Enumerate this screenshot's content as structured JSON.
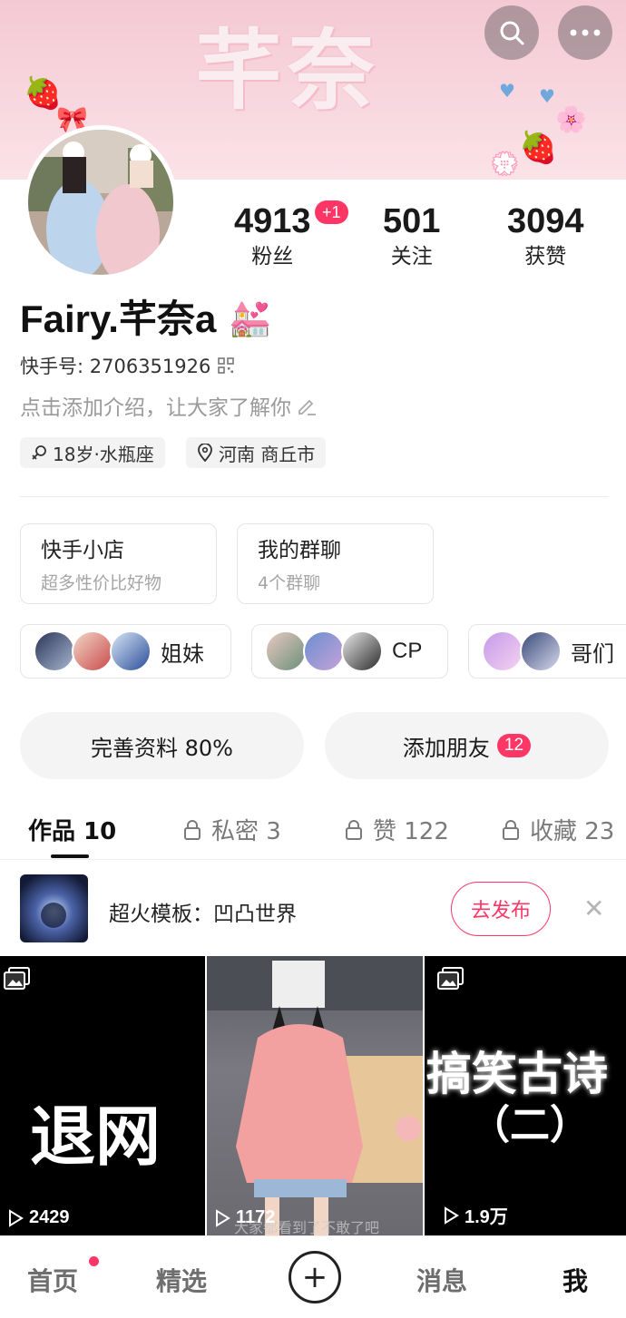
{
  "banner": {
    "title": "芊奈"
  },
  "stats": {
    "fans": {
      "value": "4913",
      "label": "粉丝",
      "badge": "+1"
    },
    "following": {
      "value": "501",
      "label": "关注"
    },
    "likes": {
      "value": "3094",
      "label": "获赞"
    }
  },
  "profile": {
    "name": "Fairy.芊奈a",
    "name_emoji": "💒",
    "id_label": "快手号: 2706351926",
    "intro": "点击添加介绍，让大家了解你",
    "tags": [
      "18岁·水瓶座",
      "河南 商丘市"
    ]
  },
  "cards": [
    {
      "title": "快手小店",
      "sub": "超多性价比好物"
    },
    {
      "title": "我的群聊",
      "sub": "4个群聊"
    }
  ],
  "groups": [
    "姐妹",
    "CP",
    "哥们"
  ],
  "actions": {
    "complete": "完善资料 80%",
    "add_friend": "添加朋友",
    "add_friend_count": "12"
  },
  "tabs": [
    {
      "label": "作品 10"
    },
    {
      "label": "私密 3"
    },
    {
      "label": "赞 122"
    },
    {
      "label": "收藏 23"
    }
  ],
  "promo": {
    "text": "超火模板：凹凸世界",
    "button": "去发布"
  },
  "videos": [
    {
      "caption": "退网",
      "views": "2429"
    },
    {
      "caption": "",
      "views": "1172",
      "overlay": "大家都看到了不敢了吧"
    },
    {
      "caption": "搞笑古诗",
      "caption2": "（二）",
      "views": "1.9万"
    }
  ],
  "nav": [
    "首页",
    "精选",
    "消息",
    "我"
  ],
  "colors": {
    "accent": "#fe3666",
    "banner_pink": "#f6cfd9"
  }
}
